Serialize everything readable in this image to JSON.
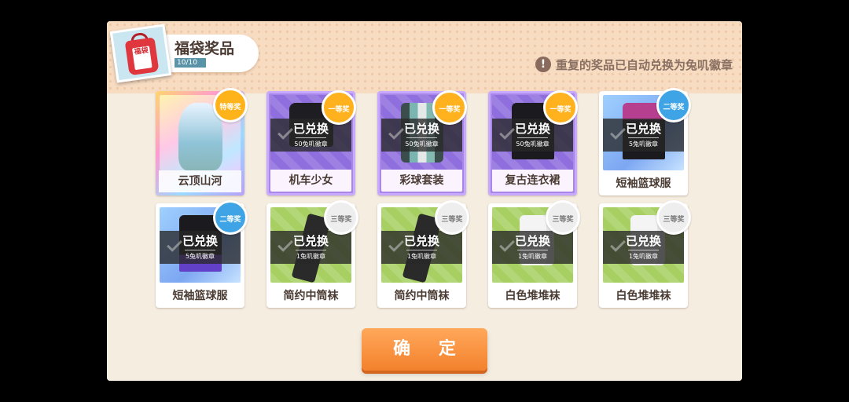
{
  "header": {
    "title": "福袋奖品",
    "progress_text": "10/10",
    "progress_fraction": 1.0,
    "bag_label": "福袋"
  },
  "notice": {
    "icon": "!",
    "text": "重复的奖品已自动兑换为兔叽徽章"
  },
  "items": [
    {
      "name": "云顶山河",
      "tier": "特等奖",
      "redeemed": false,
      "redeem_text": "",
      "redeem_value": ""
    },
    {
      "name": "机车少女",
      "tier": "一等奖",
      "redeemed": true,
      "redeem_text": "已兑换",
      "redeem_value": "50兔叽徽章"
    },
    {
      "name": "彩球套装",
      "tier": "一等奖",
      "redeemed": true,
      "redeem_text": "已兑换",
      "redeem_value": "50兔叽徽章"
    },
    {
      "name": "复古连衣裙",
      "tier": "一等奖",
      "redeemed": true,
      "redeem_text": "已兑换",
      "redeem_value": "50兔叽徽章"
    },
    {
      "name": "短袖篮球服",
      "tier": "二等奖",
      "redeemed": true,
      "redeem_text": "已兑换",
      "redeem_value": "5兔叽徽章"
    },
    {
      "name": "短袖篮球服",
      "tier": "二等奖",
      "redeemed": true,
      "redeem_text": "已兑换",
      "redeem_value": "5兔叽徽章"
    },
    {
      "name": "简约中筒袜",
      "tier": "三等奖",
      "redeemed": true,
      "redeem_text": "已兑换",
      "redeem_value": "1兔叽徽章"
    },
    {
      "name": "简约中筒袜",
      "tier": "三等奖",
      "redeemed": true,
      "redeem_text": "已兑换",
      "redeem_value": "1兔叽徽章"
    },
    {
      "name": "白色堆堆袜",
      "tier": "三等奖",
      "redeemed": true,
      "redeem_text": "已兑换",
      "redeem_value": "1兔叽徽章"
    },
    {
      "name": "白色堆堆袜",
      "tier": "三等奖",
      "redeemed": true,
      "redeem_text": "已兑换",
      "redeem_value": "1兔叽徽章"
    }
  ],
  "confirm_button": "确 定",
  "colors": {
    "accent": "#f3812d",
    "panel_bg": "#f3ecdf",
    "tier1": "#a987e8",
    "tier2": "#7da7f2",
    "tier3": "#a7cf62"
  }
}
